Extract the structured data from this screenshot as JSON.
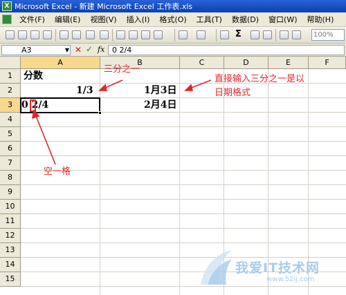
{
  "window": {
    "title": "Microsoft Excel - 新建 Microsoft Excel 工作表.xls",
    "app_icon": "excel-icon"
  },
  "menu": [
    "文件(F)",
    "编辑(E)",
    "视图(V)",
    "插入(I)",
    "格式(O)",
    "工具(T)",
    "数据(D)",
    "窗口(W)",
    "帮助(H)"
  ],
  "toolbar": {
    "zoom": "100%"
  },
  "formula_bar": {
    "name_box": "A3",
    "formula": "0 2/4"
  },
  "grid": {
    "columns": [
      "A",
      "B",
      "C",
      "D",
      "E",
      "F"
    ],
    "rows": [
      "1",
      "2",
      "3",
      "4",
      "5",
      "6",
      "7",
      "8",
      "9",
      "10",
      "11",
      "12",
      "13",
      "14",
      "15"
    ],
    "active_cell": "A3",
    "cells": {
      "A1": "分数",
      "A2": "1/3",
      "B2": "1月3日",
      "A3": "0 2/4",
      "B3": "2月4日"
    }
  },
  "annotations": {
    "fraction_label": "三分之一",
    "date_note_line1": "直接输入三分之一是以",
    "date_note_line2": "日期格式",
    "space_label": "空一格",
    "color": "#e3242b"
  },
  "watermark": {
    "text": "我爱IT技术网",
    "url": "www.52ij.com"
  }
}
